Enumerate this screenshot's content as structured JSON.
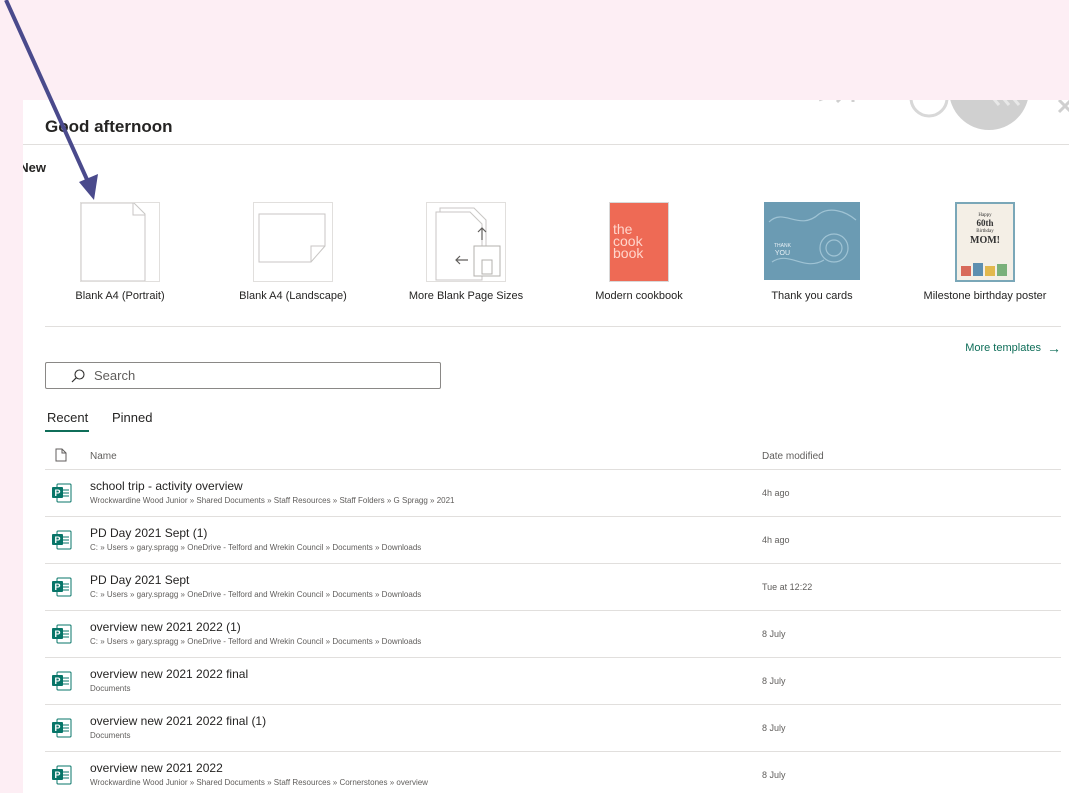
{
  "header": {
    "greeting": "Good afternoon"
  },
  "new_section": {
    "label": "New",
    "templates": [
      {
        "caption": "Blank A4 (Portrait)",
        "icon": "blank-portrait-icon"
      },
      {
        "caption": "Blank A4 (Landscape)",
        "icon": "blank-landscape-icon"
      },
      {
        "caption": "More Blank Page Sizes",
        "icon": "more-sizes-icon"
      },
      {
        "caption": "Modern cookbook",
        "thumb_text": [
          "the",
          "cook",
          "book"
        ]
      },
      {
        "caption": "Thank you cards",
        "thumb_text": [
          "THANK",
          "YOU"
        ]
      },
      {
        "caption": "Milestone birthday poster",
        "thumb_text": [
          "Happy",
          "60th",
          "Birthday",
          "MOM!"
        ]
      }
    ],
    "more_templates": "More templates"
  },
  "search": {
    "placeholder": "Search"
  },
  "tabs": {
    "recent": "Recent",
    "pinned": "Pinned"
  },
  "list": {
    "col_name": "Name",
    "col_date": "Date modified",
    "rows": [
      {
        "name": "school trip - activity overview",
        "path": "Wrockwardine Wood Junior » Shared Documents » Staff Resources » Staff Folders » G Spragg » 2021",
        "date": "4h ago"
      },
      {
        "name": "PD Day 2021 Sept (1)",
        "path": "C: » Users » gary.spragg » OneDrive - Telford and Wrekin Council » Documents » Downloads",
        "date": "4h ago"
      },
      {
        "name": "PD Day 2021 Sept",
        "path": "C: » Users » gary.spragg » OneDrive - Telford and Wrekin Council » Documents » Downloads",
        "date": "Tue at 12:22"
      },
      {
        "name": "overview new 2021 2022 (1)",
        "path": "C: » Users » gary.spragg » OneDrive - Telford and Wrekin Council » Documents » Downloads",
        "date": "8 July"
      },
      {
        "name": "overview new 2021 2022 final",
        "path": "Documents",
        "date": "8 July"
      },
      {
        "name": "overview new 2021 2022 final (1)",
        "path": "Documents",
        "date": "8 July"
      },
      {
        "name": "overview new 2021 2022",
        "path": "Wrockwardine Wood Junior » Shared Documents » Staff Resources » Cornerstones » overview",
        "date": "8 July"
      }
    ]
  },
  "colors": {
    "page_bg": "#fdeef4",
    "accent": "#0f6e59",
    "publisher_icon": "#077568",
    "annotation_arrow": "#4a4a8c"
  }
}
